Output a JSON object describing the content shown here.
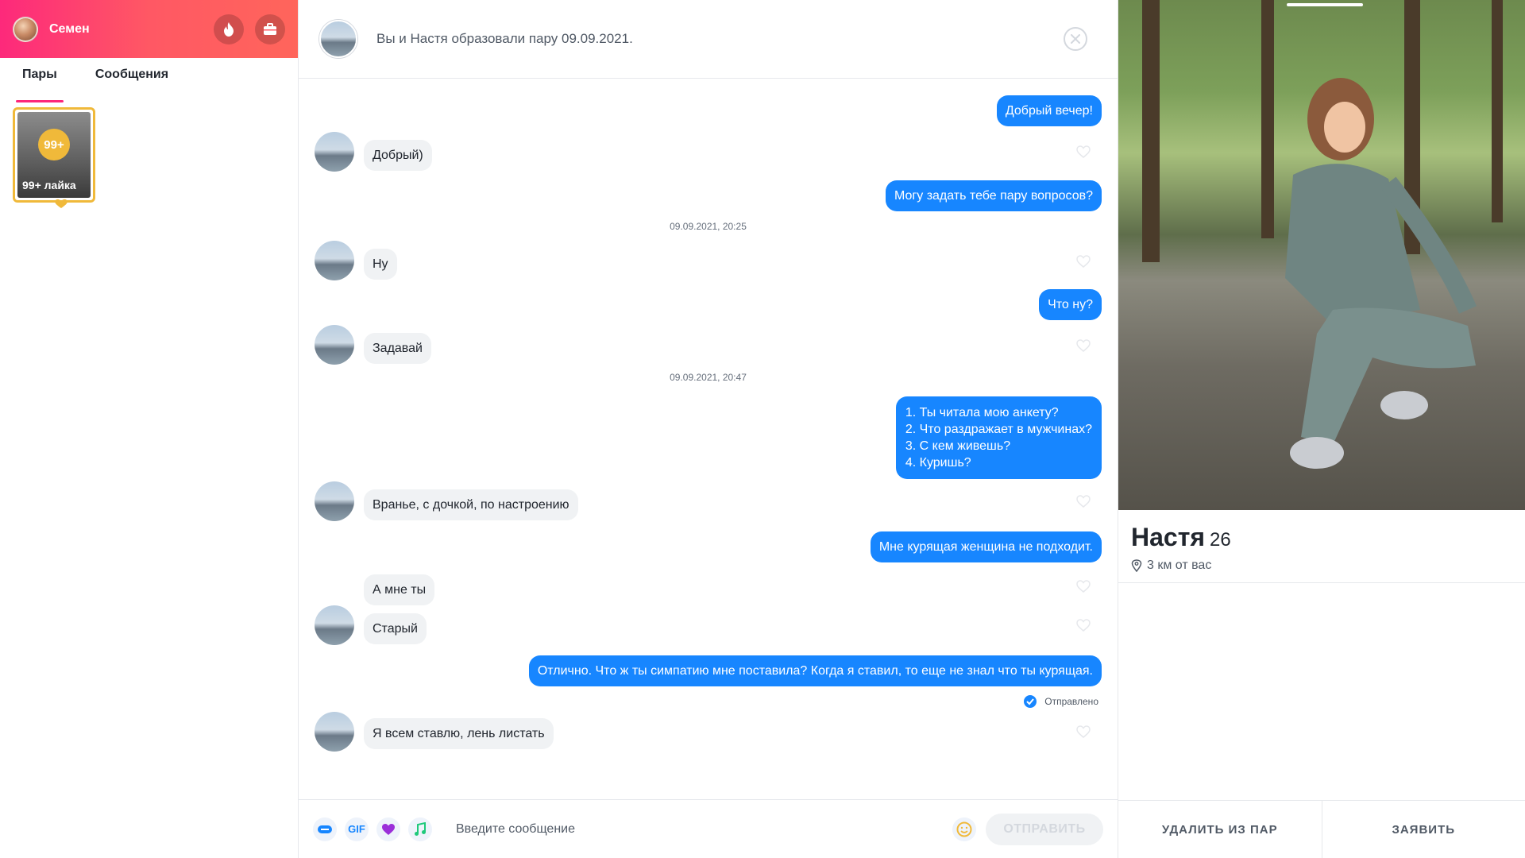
{
  "user": {
    "name": "Семен"
  },
  "tabs": [
    {
      "label": "Пары",
      "active": true
    },
    {
      "label": "Сообщения",
      "active": false
    }
  ],
  "likes_card": {
    "badge": "99+",
    "label": "99+ лайка"
  },
  "chat": {
    "match_text": "Вы и Настя образовали пару 09.09.2021.",
    "messages": [
      {
        "side": "out",
        "text": "Добрый вечер!"
      },
      {
        "side": "in",
        "text": "Добрый)"
      },
      {
        "side": "out",
        "text": "Могу задать тебе пару вопросов?"
      },
      {
        "side": "timestamp",
        "text": "09.09.2021, 20:25"
      },
      {
        "side": "in",
        "text": "Ну"
      },
      {
        "side": "out",
        "text": "Что ну?"
      },
      {
        "side": "in",
        "text": "Задавай"
      },
      {
        "side": "timestamp",
        "text": "09.09.2021, 20:47"
      },
      {
        "side": "out",
        "lines": [
          "1. Ты читала мою анкету?",
          "2. Что раздражает в мужчинах?",
          "3. С кем живешь?",
          "4. Куришь?"
        ]
      },
      {
        "side": "in",
        "text": "Вранье, с дочкой, по настроению"
      },
      {
        "side": "out",
        "text": "Мне курящая женщина не подходит."
      },
      {
        "side": "in",
        "text": "А мне ты"
      },
      {
        "side": "in",
        "text": "Старый"
      },
      {
        "side": "out",
        "text": "Отлично. Что ж ты симпатию мне поставила? Когда я ставил, то еще не знал что ты курящая."
      },
      {
        "side": "status",
        "text": "Отправлено"
      },
      {
        "side": "in",
        "text": "Я всем ставлю, лень листать"
      }
    ],
    "composer": {
      "gif_label": "GIF",
      "placeholder": "Введите сообщение",
      "send_label": "ОТПРАВИТЬ"
    }
  },
  "profile": {
    "name": "Настя",
    "age": "26",
    "distance": "3 км от вас",
    "actions": {
      "unmatch": "УДАЛИТЬ ИЗ ПАР",
      "report": "ЗАЯВИТЬ"
    }
  },
  "colors": {
    "brand_gradient_start": "#fd297b",
    "brand_gradient_end": "#ff655b",
    "outgoing_bubble": "#1786ff",
    "incoming_bubble": "#f0f2f4",
    "likes_gold": "#f0b93a"
  },
  "icons": {
    "header": [
      "flame-icon",
      "briefcase-icon"
    ],
    "composer": [
      "sticker-icon",
      "gif-icon",
      "heart-sticker-icon",
      "music-icon",
      "emoji-icon"
    ],
    "chat": [
      "close-icon",
      "heart-outline-icon",
      "delivered-check-icon"
    ],
    "profile": [
      "location-pin-icon"
    ]
  }
}
